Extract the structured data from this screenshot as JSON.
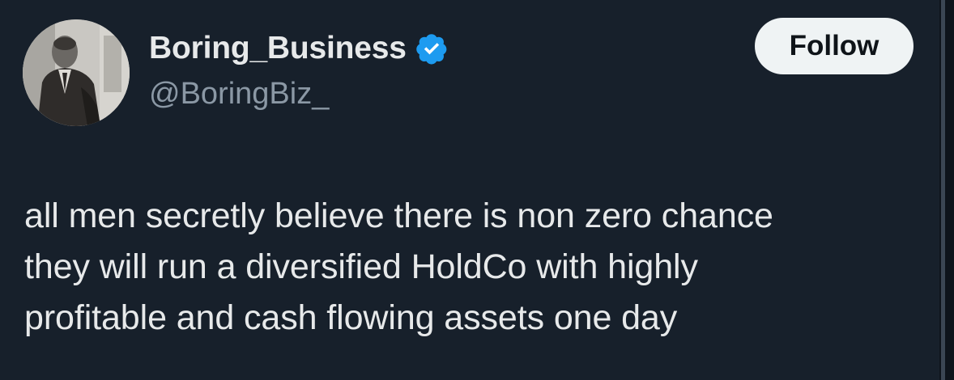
{
  "author": {
    "display_name": "Boring_Business",
    "handle": "@BoringBiz_",
    "verified": true,
    "verified_color": "#1d9bf0"
  },
  "follow_button": {
    "label": "Follow"
  },
  "tweet": {
    "lines": [
      "all men secretly believe there is non zero chance",
      "they will run a diversified HoldCo with highly",
      "profitable and cash flowing assets one day"
    ]
  },
  "colors": {
    "background": "#17202b",
    "text": "#e7e9ea",
    "secondary_text": "#8b98a5",
    "button_bg": "#eff3f4"
  }
}
